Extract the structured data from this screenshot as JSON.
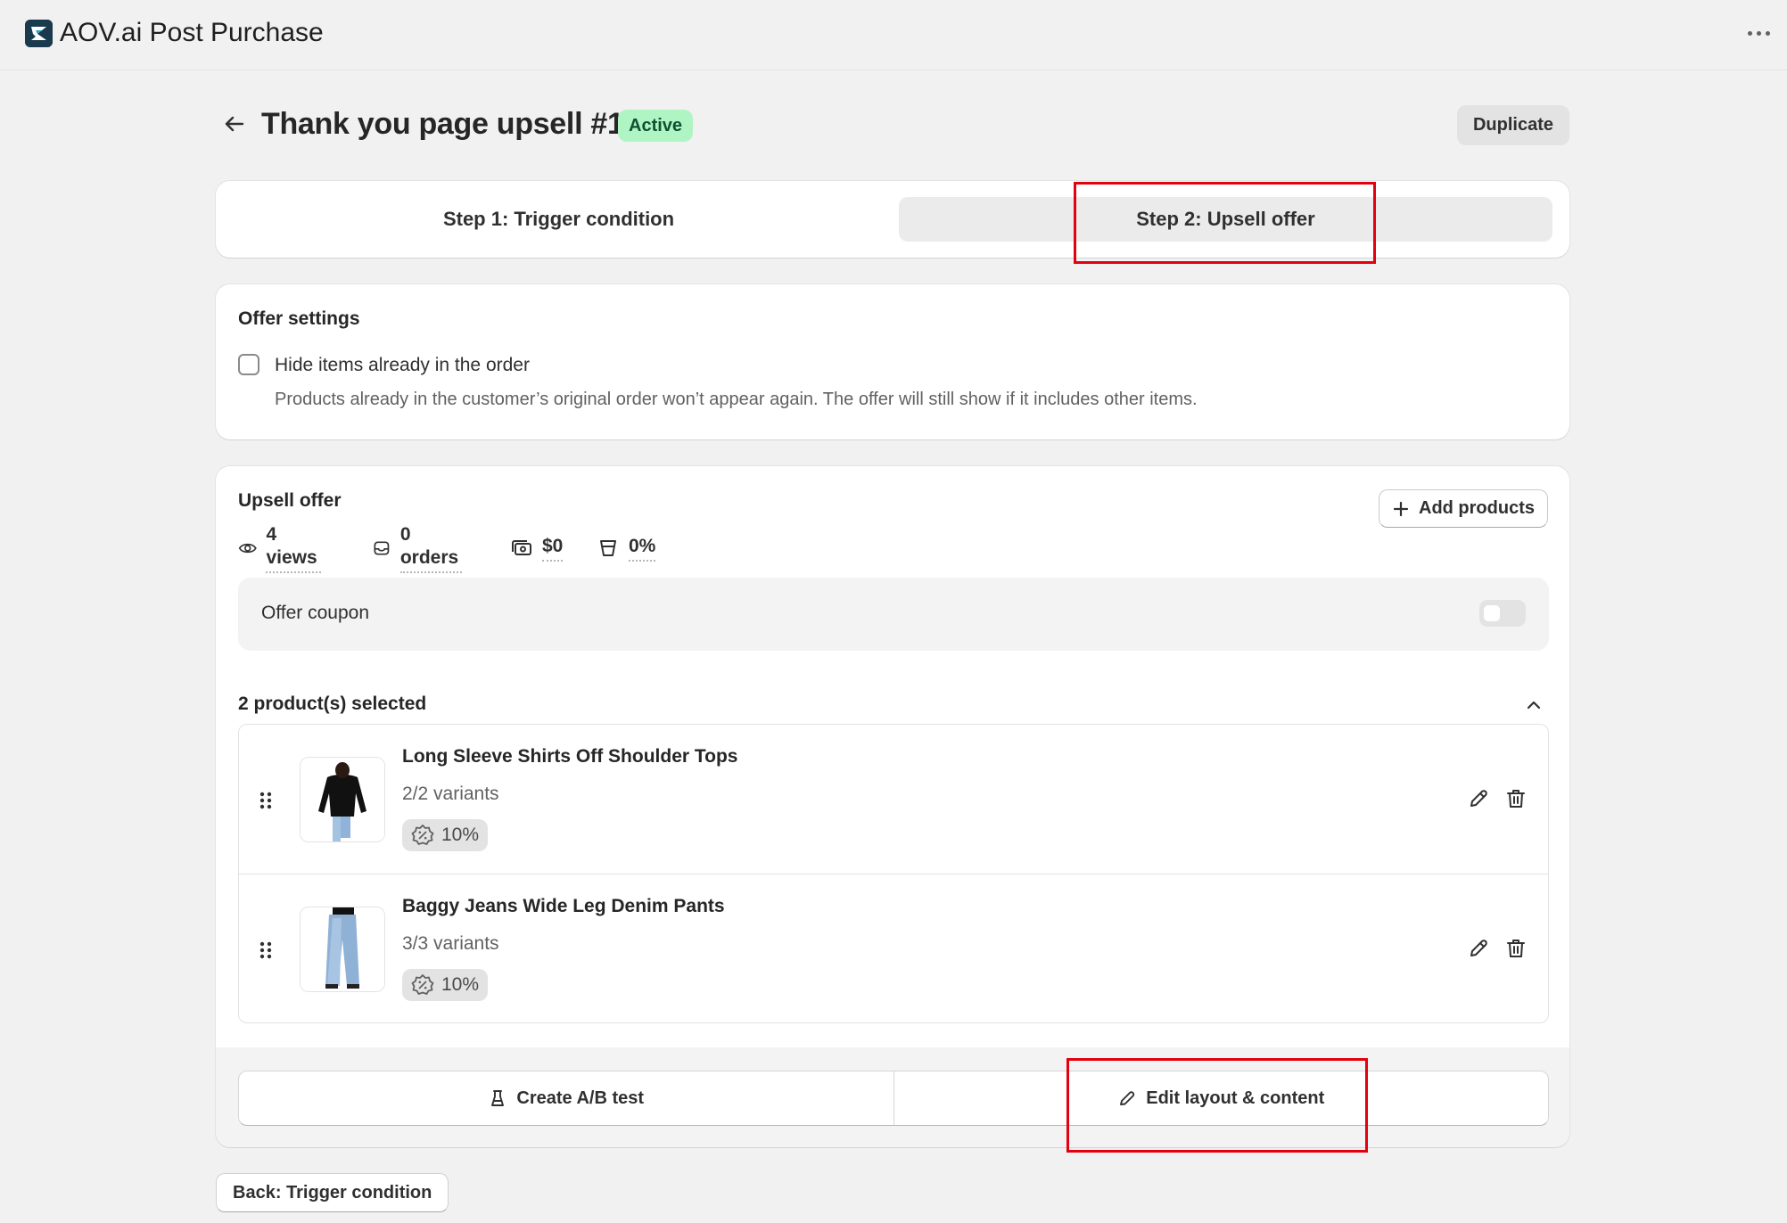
{
  "app": {
    "title": "AOV.ai Post Purchase"
  },
  "page": {
    "title": "Thank you page upsell #1",
    "status": "Active",
    "duplicate_label": "Duplicate"
  },
  "steps": [
    {
      "label": "Step 1: Trigger condition",
      "selected": false
    },
    {
      "label": "Step 2: Upsell offer",
      "selected": true
    }
  ],
  "offer_settings": {
    "title": "Offer settings",
    "hide_items_label": "Hide items already in the order",
    "hide_items_checked": false,
    "hide_items_help": "Products already in the customer’s original order won’t appear again. The offer will still show if it includes other items."
  },
  "upsell": {
    "title": "Upsell offer",
    "add_products_label": "Add products",
    "stats": {
      "views": "4 views",
      "orders": "0 orders",
      "revenue": "$0",
      "conversion": "0%"
    },
    "coupon": {
      "label": "Offer coupon",
      "enabled": false
    },
    "selected_label": "2 product(s) selected",
    "products": [
      {
        "name": "Long Sleeve Shirts Off Shoulder Tops",
        "variants": "2/2 variants",
        "discount": "10%"
      },
      {
        "name": "Baggy Jeans Wide Leg Denim Pants",
        "variants": "3/3 variants",
        "discount": "10%"
      }
    ],
    "ab_test_label": "Create A/B test",
    "edit_layout_label": "Edit layout & content"
  },
  "footer": {
    "back_label": "Back: Trigger condition"
  },
  "colors": {
    "active_badge_bg": "#aff5c4",
    "active_badge_text": "#0c5132",
    "highlight": "#e3000f"
  }
}
